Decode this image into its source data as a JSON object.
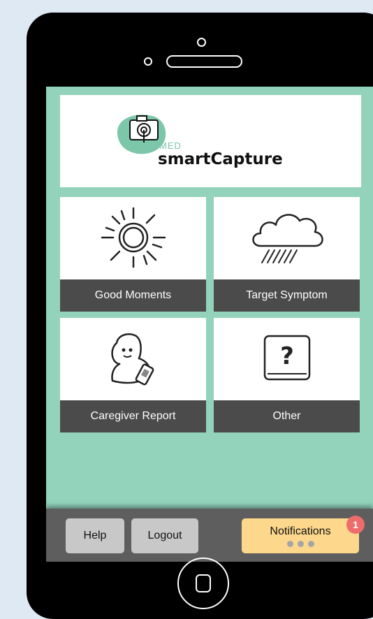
{
  "logo": {
    "med": "MED",
    "name": "smartCapture"
  },
  "tiles": [
    {
      "label": "Good Moments",
      "icon": "sun-icon"
    },
    {
      "label": "Target Symptom",
      "icon": "rain-cloud-icon"
    },
    {
      "label": "Caregiver Report",
      "icon": "caregiver-phone-icon"
    },
    {
      "label": "Other",
      "icon": "question-box-icon"
    }
  ],
  "footer": {
    "help": "Help",
    "logout": "Logout",
    "notifications": "Notifications",
    "notification_count": "1"
  },
  "colors": {
    "screen_bg": "#93d3bc",
    "tile_label_bg": "#4b4b4b",
    "notify_bg": "#fcd78c",
    "badge": "#ee6c6c"
  }
}
